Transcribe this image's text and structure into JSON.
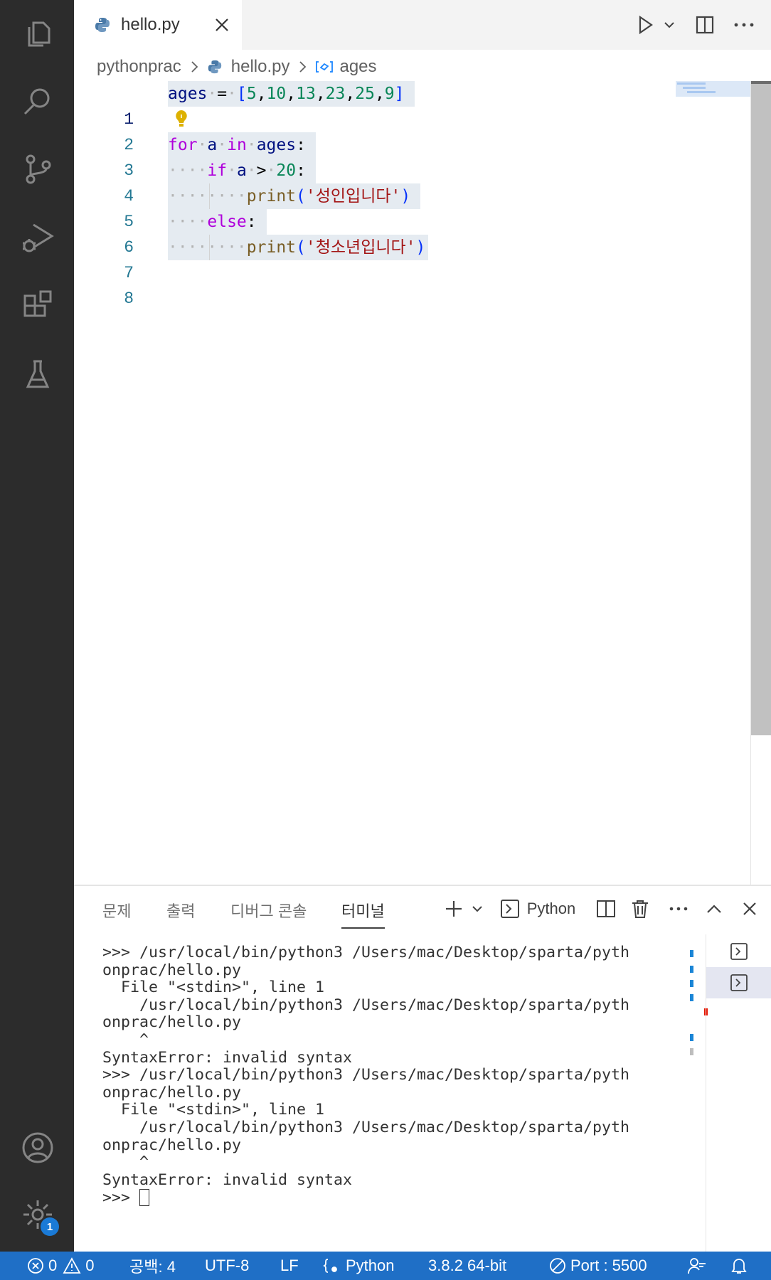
{
  "editor_tab": {
    "filename": "hello.py"
  },
  "breadcrumb": {
    "folder": "pythonprac",
    "file": "hello.py",
    "symbol": "ages"
  },
  "code_lines": [
    {
      "number": "1",
      "text": "ages = [5,10,13,23,25,9]"
    },
    {
      "number": "2",
      "text": ""
    },
    {
      "number": "3",
      "text": "for a in ages:"
    },
    {
      "number": "4",
      "text": "    if a > 20:"
    },
    {
      "number": "5",
      "text": "        print('성인입니다')"
    },
    {
      "number": "6",
      "text": "    else:"
    },
    {
      "number": "7",
      "text": "        print('청소년입니다')"
    },
    {
      "number": "8",
      "text": ""
    }
  ],
  "tokens": {
    "ages": "ages",
    "eq": "=",
    "lbr": "[",
    "rbr": "]",
    "n5": "5",
    "n10": "10",
    "n13": "13",
    "n23": "23",
    "n25": "25",
    "n9": "9",
    "comma": ",",
    "for": "for",
    "a": "a",
    "in": "in",
    "colon": ":",
    "if": "if",
    "gt": ">",
    "n20": "20",
    "print": "print",
    "lp": "(",
    "rp": ")",
    "s1": "'성인입니다'",
    "else": "else",
    "s2": "'청소년입니다'"
  },
  "panel": {
    "tabs": [
      "문제",
      "출력",
      "디버그 콘솔",
      "터미널"
    ],
    "active_tab": "터미널",
    "terminal_name": "Python"
  },
  "terminal_lines": [
    ">>> /usr/local/bin/python3 /Users/mac/Desktop/sparta/pyth",
    "onprac/hello.py",
    "  File \"<stdin>\", line 1",
    "    /usr/local/bin/python3 /Users/mac/Desktop/sparta/pyth",
    "onprac/hello.py",
    "    ^",
    "SyntaxError: invalid syntax",
    ">>> /usr/local/bin/python3 /Users/mac/Desktop/sparta/pyth",
    "onprac/hello.py",
    "  File \"<stdin>\", line 1",
    "    /usr/local/bin/python3 /Users/mac/Desktop/sparta/pyth",
    "onprac/hello.py",
    "    ^",
    "SyntaxError: invalid syntax"
  ],
  "terminal_prompt": ">>> ",
  "status_bar": {
    "errors": "0",
    "warnings": "0",
    "spaces": "공백: 4",
    "encoding": "UTF-8",
    "eol": "LF",
    "language": "Python",
    "interpreter": "3.8.2 64-bit",
    "port": "Port : 5500"
  },
  "accounts_badge": "1",
  "colors": {
    "activity_bar": "#2c2c2c",
    "status_bar": "#1f6fc6",
    "selection": "#e5ebf1",
    "keyword": "#af00db",
    "string": "#a31515",
    "number": "#098658"
  }
}
